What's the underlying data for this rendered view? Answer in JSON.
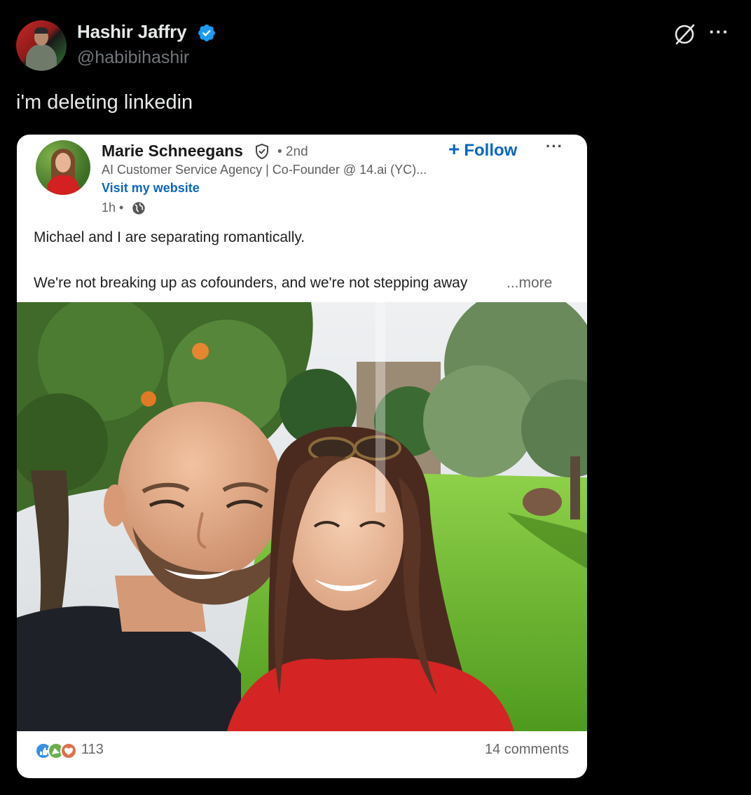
{
  "tweet": {
    "author_name": "Hashir Jaffry",
    "handle": "@habibihashir",
    "text": "i'm deleting linkedin",
    "verified": true,
    "icons": [
      "verified-badge-icon",
      "grok-icon",
      "more-icon"
    ]
  },
  "linkedin_post": {
    "author_name": "Marie Schneegans",
    "degree": "• 2nd",
    "headline": "AI Customer Service Agency | Co-Founder @ 14.ai (YC)...",
    "website_link": "Visit my website",
    "time": "1h •",
    "follow_label": "Follow",
    "line1": "Michael and I are separating romantically.",
    "line2": "We're not breaking up as cofounders, and we're not stepping away",
    "more_link": "...more",
    "reaction_count": "113",
    "comments_label": "14 comments",
    "icons": [
      "verified-shield-icon",
      "globe-icon",
      "plus-icon",
      "more-icon",
      "like-reaction-icon",
      "celebrate-reaction-icon",
      "love-reaction-icon"
    ]
  },
  "colors": {
    "background": "#000000",
    "text_primary": "#e7e9ea",
    "text_secondary": "#71767b",
    "verified_blue": "#1d9bf0",
    "linkedin_blue": "#0a66c2"
  }
}
